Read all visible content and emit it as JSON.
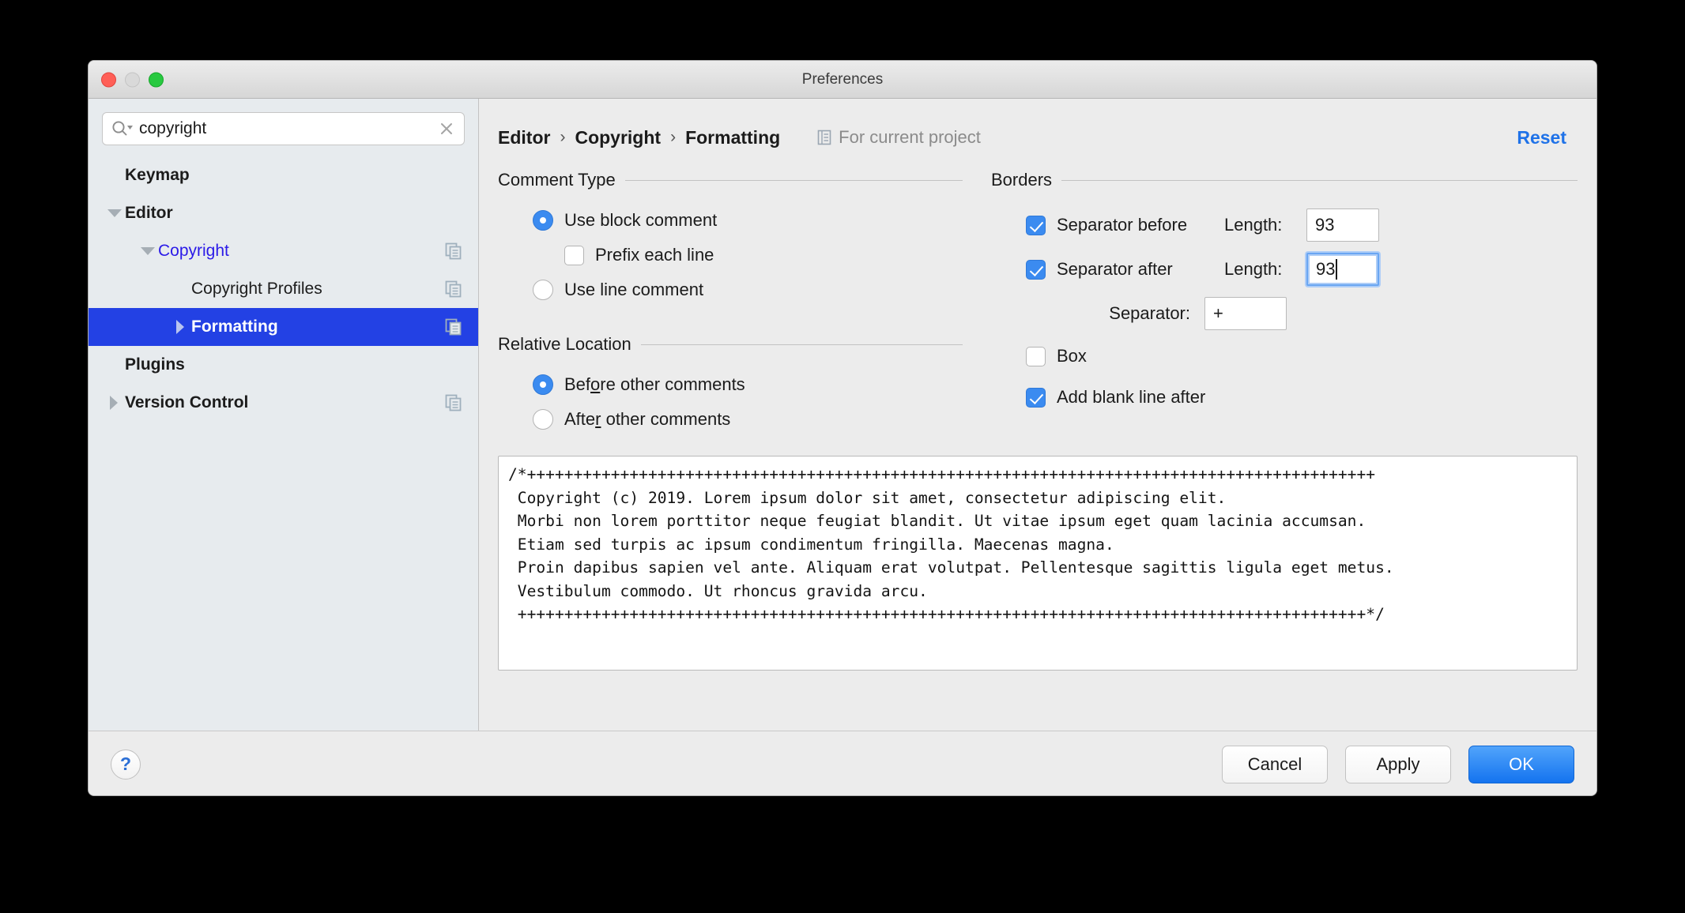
{
  "window": {
    "title": "Preferences",
    "traffic": {
      "close": "close-button",
      "minimize": "minimize-button",
      "zoom": "zoom-button"
    }
  },
  "search": {
    "value": "copyright",
    "placeholder": "Search",
    "icon": "search-icon",
    "clear_icon": "clear-icon"
  },
  "sidebar": {
    "items": [
      {
        "label": "Keymap",
        "indent": 0,
        "bold": true,
        "twisty": "none",
        "selected": false,
        "link": false,
        "copy_icon": false
      },
      {
        "label": "Editor",
        "indent": 0,
        "bold": true,
        "twisty": "down",
        "selected": false,
        "link": false,
        "copy_icon": false
      },
      {
        "label": "Copyright",
        "indent": 1,
        "bold": false,
        "twisty": "down",
        "selected": false,
        "link": true,
        "copy_icon": true
      },
      {
        "label": "Copyright Profiles",
        "indent": 2,
        "bold": false,
        "twisty": "none",
        "selected": false,
        "link": false,
        "copy_icon": true
      },
      {
        "label": "Formatting",
        "indent": 2,
        "bold": true,
        "twisty": "right",
        "selected": true,
        "link": false,
        "copy_icon": true
      },
      {
        "label": "Plugins",
        "indent": 0,
        "bold": true,
        "twisty": "none",
        "selected": false,
        "link": false,
        "copy_icon": false
      },
      {
        "label": "Version Control",
        "indent": 0,
        "bold": true,
        "twisty": "right",
        "selected": false,
        "link": false,
        "copy_icon": true
      }
    ]
  },
  "header": {
    "breadcrumb": [
      "Editor",
      "Copyright",
      "Formatting"
    ],
    "separator": "›",
    "scope_label": "For current project",
    "scope_icon": "project-scope-icon",
    "reset_label": "Reset"
  },
  "comment_type": {
    "title": "Comment Type",
    "block_label": "Use block comment",
    "block_selected": true,
    "prefix_label": "Prefix each line",
    "prefix_checked": false,
    "line_label": "Use line comment",
    "line_selected": false
  },
  "relative_location": {
    "title": "Relative Location",
    "before_label_pre": "Bef",
    "before_label_mn": "o",
    "before_label_post": "re other comments",
    "before_selected": true,
    "after_label_pre": "Afte",
    "after_label_mn": "r",
    "after_label_post": " other comments",
    "after_selected": false
  },
  "borders": {
    "title": "Borders",
    "separator_before_label": "Separator before",
    "separator_before_checked": true,
    "length_before_label": "Length:",
    "length_before_value": "93",
    "separator_after_label": "Separator after",
    "separator_after_checked": true,
    "length_after_label": "Length:",
    "length_after_value": "93",
    "length_after_focused": true,
    "separator_label": "Separator:",
    "separator_value": "+",
    "box_label": "Box",
    "box_checked": false,
    "blank_line_label": "Add blank line after",
    "blank_line_checked": true
  },
  "preview": {
    "text": "/*+++++++++++++++++++++++++++++++++++++++++++++++++++++++++++++++++++++++++++++++++++++++++++\n Copyright (c) 2019. Lorem ipsum dolor sit amet, consectetur adipiscing elit.\n Morbi non lorem porttitor neque feugiat blandit. Ut vitae ipsum eget quam lacinia accumsan.\n Etiam sed turpis ac ipsum condimentum fringilla. Maecenas magna.\n Proin dapibus sapien vel ante. Aliquam erat volutpat. Pellentesque sagittis ligula eget metus.\n Vestibulum commodo. Ut rhoncus gravida arcu.\n +++++++++++++++++++++++++++++++++++++++++++++++++++++++++++++++++++++++++++++++++++++++++++*/"
  },
  "footer": {
    "help_label": "?",
    "cancel_label": "Cancel",
    "apply_label": "Apply",
    "ok_label": "OK"
  },
  "colors": {
    "selection_blue": "#2341e4",
    "accent_blue": "#3b8bf0",
    "link_blue": "#1f72e8",
    "tree_link": "#2b1ae8",
    "ok_blue": "#1473ef"
  }
}
